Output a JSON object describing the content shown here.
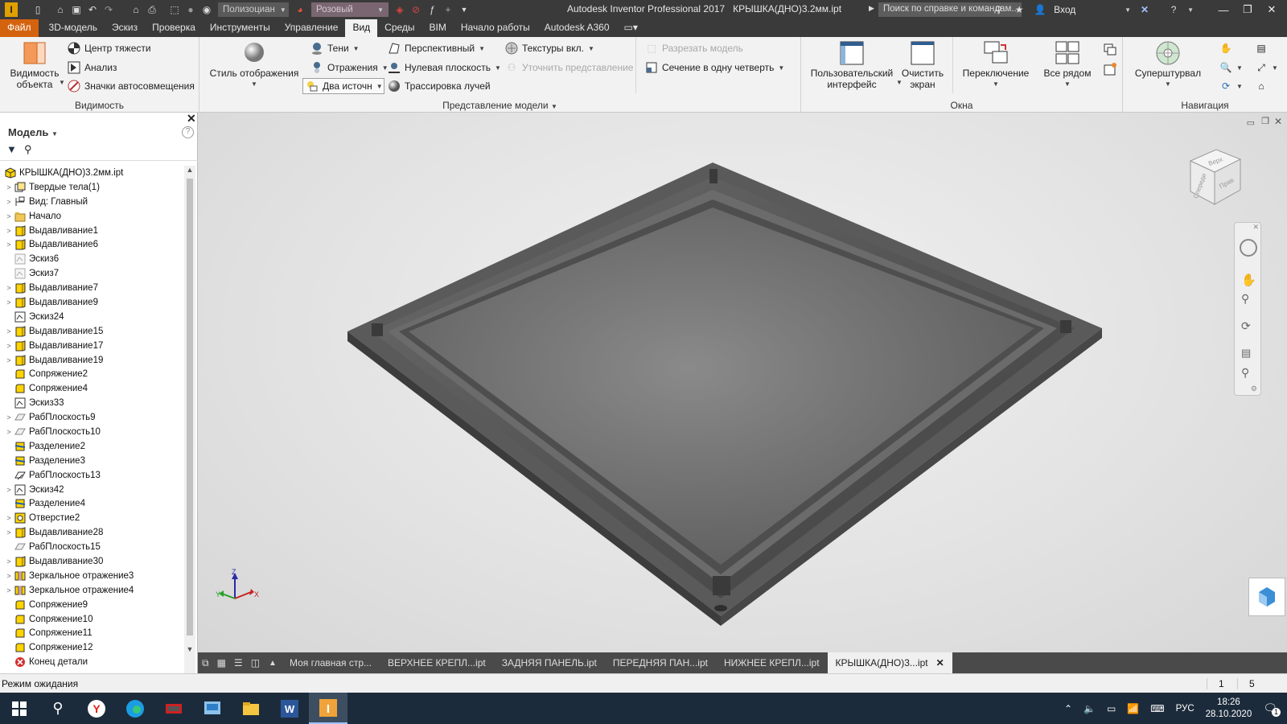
{
  "titlebar": {
    "app_title": "Autodesk Inventor Professional 2017",
    "doc_title": "КРЫШКА(ДНО)3.2мм.ipt",
    "material": "Полизоциан",
    "appearance": "Розовый",
    "search_placeholder": "Поиск по справке и командам...",
    "login": "Вход"
  },
  "menu_tabs": [
    "Файл",
    "3D-модель",
    "Эскиз",
    "Проверка",
    "Инструменты",
    "Управление",
    "Вид",
    "Среды",
    "BIM",
    "Начало работы",
    "Autodesk A360"
  ],
  "active_tab": "Вид",
  "ribbon": {
    "visibility": {
      "title": "Видимость",
      "object_visibility": "Видимость объекта",
      "center_of_gravity": "Центр тяжести",
      "analysis": "Анализ",
      "dof_symbols": "Значки автосовмещения"
    },
    "model_view": {
      "title": "Представление модели",
      "display_style": "Стиль отображения",
      "shadows": "Тени",
      "reflections": "Отражения",
      "two_lights": "Два источн",
      "perspective": "Перспективный",
      "ground_plane": "Нулевая плоскость",
      "ray_tracing": "Трассировка лучей",
      "textures": "Текстуры вкл.",
      "refine_view": "Уточнить представление",
      "section_model": "Разрезать модель",
      "quarter_section": "Сечение в одну четверть"
    },
    "windows": {
      "title": "Окна",
      "user_interface": "Пользовательский интерфейс",
      "clean_screen": "Очистить экран",
      "switch": "Переключение",
      "tile": "Все рядом"
    },
    "navigation": {
      "title": "Навигация",
      "steering_wheels": "Суперштурвал"
    }
  },
  "browser": {
    "title": "Модель",
    "root": "КРЫШКА(ДНО)3.2мм.ipt",
    "items": [
      {
        "label": "Твердые тела(1)",
        "icon": "solid-bodies",
        "expand": true
      },
      {
        "label": "Вид: Главный",
        "icon": "view",
        "expand": true
      },
      {
        "label": "Начало",
        "icon": "folder",
        "expand": true
      },
      {
        "label": "Выдавливание1",
        "icon": "extrude",
        "expand": true
      },
      {
        "label": "Выдавливание6",
        "icon": "extrude",
        "expand": true
      },
      {
        "label": "Эскиз6",
        "icon": "sketch-off",
        "expand": false
      },
      {
        "label": "Эскиз7",
        "icon": "sketch-off",
        "expand": false
      },
      {
        "label": "Выдавливание7",
        "icon": "extrude",
        "expand": true
      },
      {
        "label": "Выдавливание9",
        "icon": "extrude",
        "expand": true
      },
      {
        "label": "Эскиз24",
        "icon": "sketch",
        "expand": false
      },
      {
        "label": "Выдавливание15",
        "icon": "extrude",
        "expand": true
      },
      {
        "label": "Выдавливание17",
        "icon": "extrude",
        "expand": true
      },
      {
        "label": "Выдавливание19",
        "icon": "extrude",
        "expand": true
      },
      {
        "label": "Сопряжение2",
        "icon": "fillet",
        "expand": false
      },
      {
        "label": "Сопряжение4",
        "icon": "fillet",
        "expand": false
      },
      {
        "label": "Эскиз33",
        "icon": "sketch",
        "expand": false
      },
      {
        "label": "РабПлоскость9",
        "icon": "workplane",
        "expand": true
      },
      {
        "label": "РабПлоскость10",
        "icon": "workplane",
        "expand": true
      },
      {
        "label": "Разделение2",
        "icon": "split",
        "expand": false
      },
      {
        "label": "Разделение3",
        "icon": "split",
        "expand": false
      },
      {
        "label": "РабПлоскость13",
        "icon": "workplane-sketch",
        "expand": false
      },
      {
        "label": "Эскиз42",
        "icon": "sketch",
        "expand": true
      },
      {
        "label": "Разделение4",
        "icon": "split",
        "expand": false
      },
      {
        "label": "Отверстие2",
        "icon": "hole",
        "expand": true
      },
      {
        "label": "Выдавливание28",
        "icon": "extrude",
        "expand": true
      },
      {
        "label": "РабПлоскость15",
        "icon": "workplane",
        "expand": false
      },
      {
        "label": "Выдавливание30",
        "icon": "extrude",
        "expand": true
      },
      {
        "label": "Зеркальное отражение3",
        "icon": "mirror",
        "expand": true
      },
      {
        "label": "Зеркальное отражение4",
        "icon": "mirror",
        "expand": true
      },
      {
        "label": "Сопряжение9",
        "icon": "fillet",
        "expand": false
      },
      {
        "label": "Сопряжение10",
        "icon": "fillet",
        "expand": false
      },
      {
        "label": "Сопряжение11",
        "icon": "fillet",
        "expand": false
      },
      {
        "label": "Сопряжение12",
        "icon": "fillet",
        "expand": false
      },
      {
        "label": "Конец детали",
        "icon": "end-of-part",
        "expand": false
      }
    ]
  },
  "viewcube": {
    "top": "Верх",
    "front": "Спереди",
    "right": "Прав"
  },
  "triad": {
    "z": "Z",
    "y": "Y",
    "x": "X"
  },
  "doc_tabs": [
    "Моя главная стр...",
    "ВЕРХНЕЕ КРЕПЛ...ipt",
    "ЗАДНЯЯ ПАНЕЛЬ.ipt",
    "ПЕРЕДНЯЯ ПАН...ipt",
    "НИЖНЕЕ КРЕПЛ...ipt",
    "КРЫШКА(ДНО)3...ipt"
  ],
  "active_doc_tab": 5,
  "status": {
    "text": "Режим ожидания",
    "count1": "1",
    "count2": "5"
  },
  "taskbar": {
    "lang": "РУС",
    "time": "18:26",
    "date": "28.10.2020",
    "notif": "1"
  },
  "colors": {
    "titlebar": "#3a3a3a",
    "file_tab": "#d4630f",
    "ribbon": "#f2f2f2",
    "taskbar": "#1c2b3b",
    "part": "#5b5b5b"
  }
}
